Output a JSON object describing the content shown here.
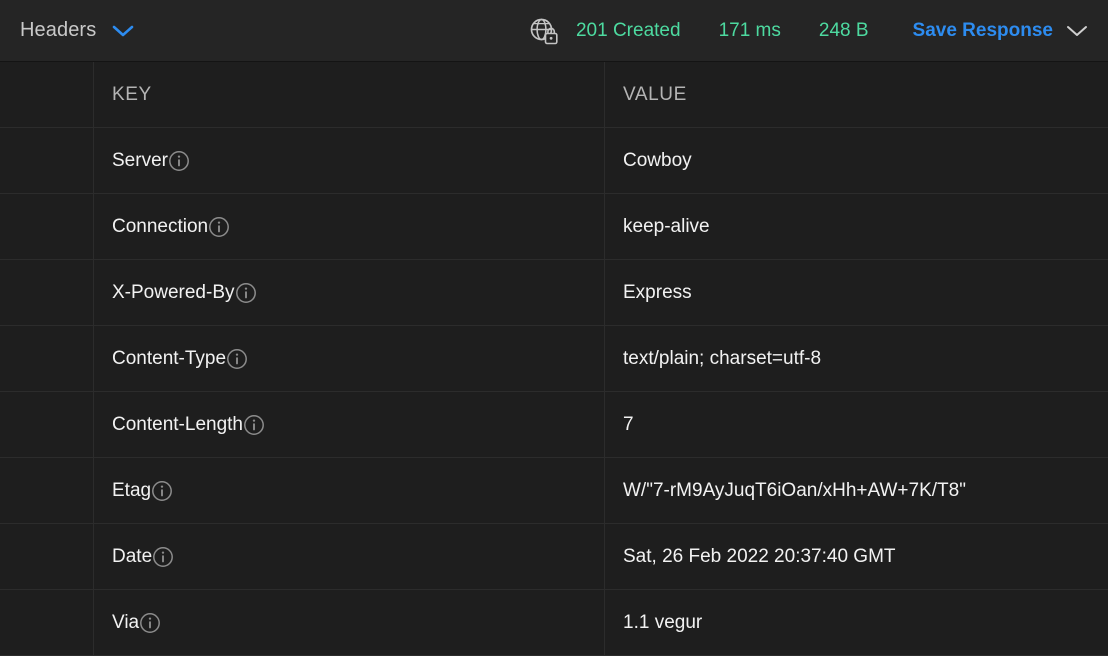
{
  "toolbar": {
    "section_label": "Headers",
    "section_chevron_icon": "chevron-down-icon",
    "connection_icon": "globe-lock-icon",
    "status_code": "201 Created",
    "time": "171 ms",
    "size": "248 B",
    "save_label": "Save Response",
    "save_chevron_icon": "chevron-down-icon",
    "accent_blue": "#2d8cf0",
    "status_green": "#4ddaa0"
  },
  "table": {
    "columns": [
      "KEY",
      "VALUE"
    ],
    "info_icon": "info-circle-icon",
    "rows": [
      {
        "key": "Server",
        "value": "Cowboy"
      },
      {
        "key": "Connection",
        "value": "keep-alive"
      },
      {
        "key": "X-Powered-By",
        "value": "Express"
      },
      {
        "key": "Content-Type",
        "value": "text/plain; charset=utf-8"
      },
      {
        "key": "Content-Length",
        "value": "7"
      },
      {
        "key": "Etag",
        "value": "W/\"7-rM9AyJuqT6iOan/xHh+AW+7K/T8\""
      },
      {
        "key": "Date",
        "value": "Sat, 26 Feb 2022 20:37:40 GMT"
      },
      {
        "key": "Via",
        "value": "1.1 vegur"
      }
    ]
  }
}
